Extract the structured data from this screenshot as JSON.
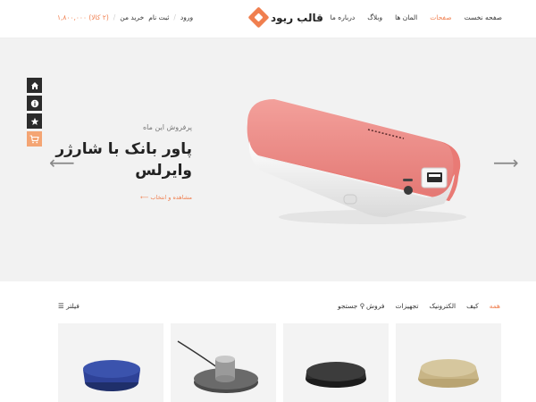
{
  "header": {
    "logo_text": "قالب ریود",
    "nav": [
      "صفحه نخست",
      "صفحات",
      "المان ها",
      "وبلاگ",
      "درباره ما"
    ],
    "nav_active_index": 1,
    "account": {
      "cart_total": "(۲ کالا) ۱,۸۰۰,۰۰۰",
      "my_purchases": "خرید من",
      "register": "ثبت نام",
      "login": "ورود"
    }
  },
  "hero": {
    "kicker": "پرفروش این ماه",
    "headline_line1": "پاور بانک با شارژر",
    "headline_line2": "وایرلس",
    "cta": "مشاهده و انتخاب",
    "prev_arrow": "⟵",
    "next_arrow": "⟶",
    "side_icons": [
      "home-icon",
      "info-icon",
      "star-icon",
      "cart-icon"
    ]
  },
  "filters": {
    "categories": [
      "همه",
      "کیف",
      "الکترونیک",
      "تجهیزات",
      "فروش"
    ],
    "active_index": 0,
    "search_label": "جستجو",
    "filter_label": "فیلتر"
  },
  "colors": {
    "accent": "#f07f4f",
    "hero_bg": "#f2f2f2",
    "dark_icon_bg": "#2b2b2b",
    "product_pink": "#ee8a86"
  }
}
